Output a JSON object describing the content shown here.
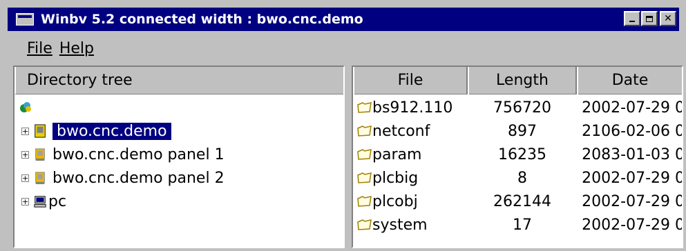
{
  "window": {
    "title": "Winbv 5.2 connected width : bwo.cnc.demo"
  },
  "menu": {
    "file": "File",
    "help": "Help"
  },
  "tree": {
    "header": "Directory tree",
    "items": [
      {
        "label": "bwo.cnc.demo",
        "selected": true
      },
      {
        "label": "bwo.cnc.demo panel 1",
        "selected": false
      },
      {
        "label": "bwo.cnc.demo panel 2",
        "selected": false
      },
      {
        "label": "pc",
        "selected": false
      }
    ]
  },
  "files": {
    "columns": [
      "File",
      "Length",
      "Date"
    ],
    "rows": [
      {
        "name": "bs912.110",
        "length": "756720",
        "date": "2002-07-29 0"
      },
      {
        "name": "netconf",
        "length": "897",
        "date": "2106-02-06 0"
      },
      {
        "name": "param",
        "length": "16235",
        "date": "2083-01-03 0"
      },
      {
        "name": "plcbig",
        "length": "8",
        "date": "2002-07-29 0"
      },
      {
        "name": "plcobj",
        "length": "262144",
        "date": "2002-07-29 0"
      },
      {
        "name": "system",
        "length": "17",
        "date": "2002-07-29 0"
      }
    ]
  },
  "colors": {
    "titlebar": "#000080",
    "selection": "#000080",
    "chrome": "#c0c0c0"
  }
}
